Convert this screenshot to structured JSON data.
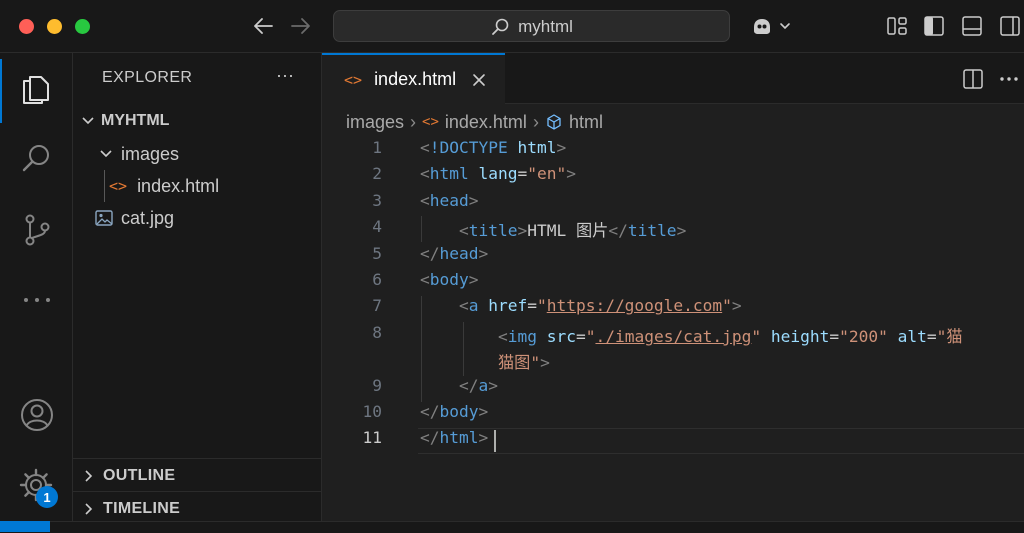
{
  "title_bar": {
    "command_center_text": "myhtml"
  },
  "activity_bar": {
    "settings_badge": "1"
  },
  "explorer": {
    "title": "EXPLORER",
    "more_label": "···",
    "root_folder": "MYHTML",
    "tree": [
      {
        "label": "images"
      },
      {
        "label": "index.html"
      },
      {
        "label": "cat.jpg"
      }
    ],
    "outline_label": "OUTLINE",
    "timeline_label": "TIMELINE"
  },
  "editor": {
    "tab_label": "index.html",
    "breadcrumb": [
      "images",
      "index.html",
      "html"
    ],
    "lines": [
      {
        "n": "1",
        "html": "<span class='g'>&lt;</span><span class='t'>!DOCTYPE</span> <span class='a'>html</span><span class='g'>&gt;</span>"
      },
      {
        "n": "2",
        "html": "<span class='g'>&lt;</span><span class='t'>html</span> <span class='a'>lang</span>=<span class='s'>\"en\"</span><span class='g'>&gt;</span>"
      },
      {
        "n": "3",
        "html": "<span class='g'>&lt;</span><span class='t'>head</span><span class='g'>&gt;</span>"
      },
      {
        "n": "4",
        "html": "    <span class='g'>&lt;</span><span class='t'>title</span><span class='g'>&gt;</span>HTML 图片<span class='g'>&lt;/</span><span class='t'>title</span><span class='g'>&gt;</span>"
      },
      {
        "n": "5",
        "html": "<span class='g'>&lt;/</span><span class='t'>head</span><span class='g'>&gt;</span>"
      },
      {
        "n": "6",
        "html": "<span class='g'>&lt;</span><span class='t'>body</span><span class='g'>&gt;</span>"
      },
      {
        "n": "7",
        "html": "    <span class='g'>&lt;</span><span class='t'>a</span> <span class='a'>href</span>=<span class='s'>\"<u>https://google.com</u>\"</span><span class='g'>&gt;</span>"
      },
      {
        "n": "8",
        "html": "        <span class='g'>&lt;</span><span class='t'>img</span> <span class='a'>src</span>=<span class='s'>\"<u>./images/cat.jpg</u>\"</span> <span class='a'>height</span>=<span class='s'>\"200\"</span> <span class='a'>alt</span>=<span class='s'>\"猫</span>"
      },
      {
        "n": "",
        "html": "        <span class='s'>猫图\"</span><span class='g'>&gt;</span>"
      },
      {
        "n": "9",
        "html": "    <span class='g'>&lt;/</span><span class='t'>a</span><span class='g'>&gt;</span>"
      },
      {
        "n": "10",
        "html": "<span class='g'>&lt;/</span><span class='t'>body</span><span class='g'>&gt;</span>"
      },
      {
        "n": "11",
        "html": "<span class='g'>&lt;/</span><span class='t'>html</span><span class='g'>&gt;</span>"
      }
    ],
    "active_line": "11"
  },
  "colors": {
    "accent": "#0078d4",
    "tag": "#569cd6",
    "attribute": "#9cdcfe",
    "string": "#ce9178",
    "html_icon": "#e37933",
    "badge": "#0078d4"
  }
}
